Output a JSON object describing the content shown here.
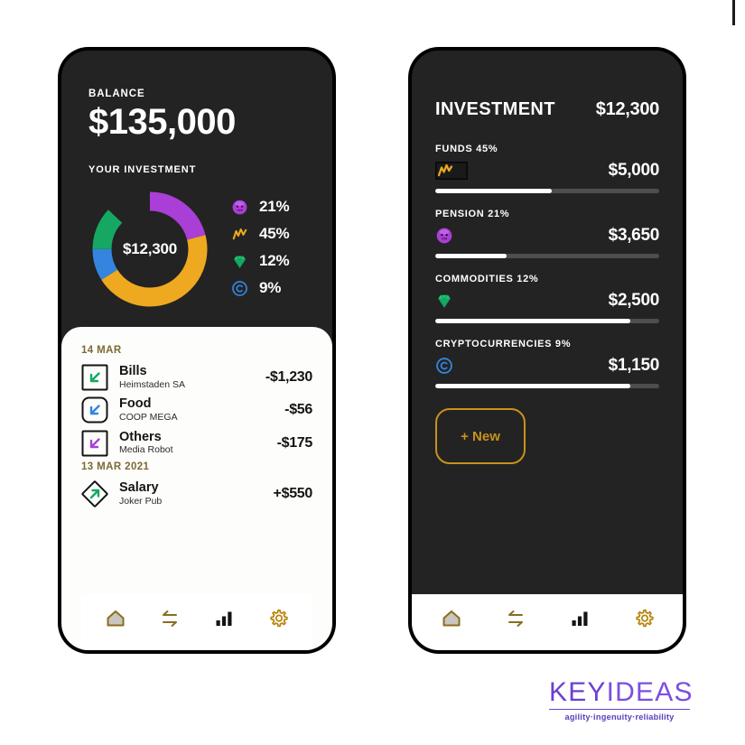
{
  "colors": {
    "pension_purple": "#a93fd6",
    "funds_orange": "#efa920",
    "commodities_green": "#16a863",
    "crypto_blue": "#3385e0",
    "gold": "#c8921c",
    "dark_bg": "#232323",
    "brand_purple": "#6b3fd4"
  },
  "phone_left": {
    "balance": {
      "label": "BALANCE",
      "amount": "$135,000"
    },
    "investment_section": {
      "label": "YOUR INVESTMENT",
      "center_amount": "$12,300",
      "legend": [
        {
          "icon": "pension-face-icon",
          "pct": "21%"
        },
        {
          "icon": "funds-zigzag-icon",
          "pct": "45%"
        },
        {
          "icon": "commodities-gem-icon",
          "pct": "12%"
        },
        {
          "icon": "crypto-coin-icon",
          "pct": "9%"
        }
      ]
    },
    "transactions": {
      "groups": [
        {
          "date": "14 MAR",
          "items": [
            {
              "icon": "arrow-down-left-icon",
              "icon_color": "#16a863",
              "shape": "square",
              "title": "Bills",
              "sub": "Heimstaden SA",
              "amount": "-$1,230"
            },
            {
              "icon": "arrow-down-left-icon",
              "icon_color": "#3385e0",
              "shape": "rounded",
              "title": "Food",
              "sub": "COOP MEGA",
              "amount": "-$56"
            },
            {
              "icon": "arrow-down-left-icon",
              "icon_color": "#a93fd6",
              "shape": "square",
              "title": "Others",
              "sub": "Media Robot",
              "amount": "-$175"
            }
          ]
        },
        {
          "date": "13 MAR 2021",
          "items": [
            {
              "icon": "arrow-up-right-icon",
              "icon_color": "#16a863",
              "shape": "diamond",
              "title": "Salary",
              "sub": "Joker Pub",
              "amount": "+$550"
            }
          ]
        }
      ]
    },
    "nav": [
      {
        "icon": "home-icon",
        "active": false
      },
      {
        "icon": "transfer-icon",
        "active": false
      },
      {
        "icon": "bar-chart-icon",
        "active": true
      },
      {
        "icon": "gear-icon",
        "active": false
      }
    ]
  },
  "phone_right": {
    "header": {
      "title": "INVESTMENT",
      "amount": "$12,300"
    },
    "blocks": [
      {
        "label": "FUNDS 45%",
        "icon": "funds-zigzag-icon",
        "amount": "$5,000",
        "bar_pct": 52
      },
      {
        "label": "PENSION 21%",
        "icon": "pension-face-icon",
        "amount": "$3,650",
        "bar_pct": 32
      },
      {
        "label": "COMMODITIES 12%",
        "icon": "commodities-gem-icon",
        "amount": "$2,500",
        "bar_pct": 87
      },
      {
        "label": "CRYPTOCURRENCIES 9%",
        "icon": "crypto-coin-icon",
        "amount": "$1,150",
        "bar_pct": 87
      }
    ],
    "new_button": "+ New",
    "nav": [
      {
        "icon": "home-icon",
        "active": false
      },
      {
        "icon": "transfer-icon",
        "active": false
      },
      {
        "icon": "bar-chart-icon",
        "active": true
      },
      {
        "icon": "gear-icon",
        "active": false
      }
    ]
  },
  "brand": {
    "name_part1": "KEY",
    "name_part2": "IDEAS",
    "tagline": "agility·ingenuity·reliability"
  },
  "chart_data": {
    "type": "pie",
    "title": "YOUR INVESTMENT",
    "center_label": "$12,300",
    "categories": [
      "Pension",
      "Funds",
      "Commodities",
      "Cryptocurrencies"
    ],
    "values": [
      21,
      45,
      12,
      9
    ],
    "amounts": [
      "$3,650",
      "$5,000",
      "$2,500",
      "$1,150"
    ],
    "colors": [
      "#a93fd6",
      "#efa920",
      "#3385e0",
      "#16a863"
    ],
    "slice_order": [
      "Pension 21% purple",
      "Funds 45% orange",
      "Cryptocurrencies 9% blue",
      "Commodities 12% green"
    ],
    "legend": [
      "21%",
      "45%",
      "12%",
      "9%"
    ],
    "legend_position": "right",
    "donut": true
  }
}
